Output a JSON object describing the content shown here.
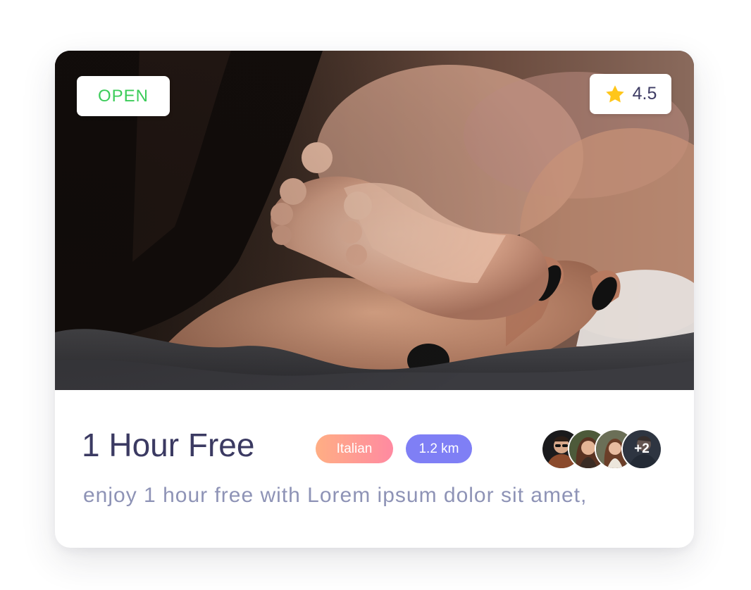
{
  "card": {
    "status_badge": "OPEN",
    "rating": "4.5",
    "title": "1 Hour Free",
    "tags": [
      "Italian",
      "1.2 km"
    ],
    "avatars": {
      "more_label": "+2"
    },
    "description": "enjoy 1 hour free with Lorem ipsum dolor sit amet,"
  },
  "colors": {
    "status_open": "#3ccc5a",
    "rating_star": "#ffc61a",
    "title_text": "#3b3a62",
    "description_text": "#8e93b6",
    "tag_cuisine_gradient": [
      "#ffae84",
      "#ff8aa1"
    ],
    "tag_distance": "#7f7ff5"
  },
  "icons": {
    "rating": "star-icon"
  }
}
